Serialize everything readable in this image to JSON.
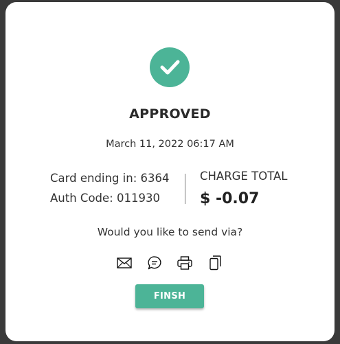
{
  "status": {
    "title": "APPROVED",
    "datetime": "March 11, 2022 06:17 AM",
    "icon": "check-circle-icon"
  },
  "details": {
    "card_ending": "Card ending in: 6364",
    "auth_code": "Auth Code: 011930"
  },
  "charge": {
    "label": "CHARGE TOTAL",
    "value": "$ -0.07"
  },
  "send": {
    "prompt": "Would you like to send via?",
    "options": [
      "email-icon",
      "sms-icon",
      "print-icon",
      "copy-icon"
    ]
  },
  "actions": {
    "finish_label": "FINSH"
  },
  "colors": {
    "accent": "#4cb497",
    "background": "#3a3a3a",
    "panel": "#ffffff"
  }
}
